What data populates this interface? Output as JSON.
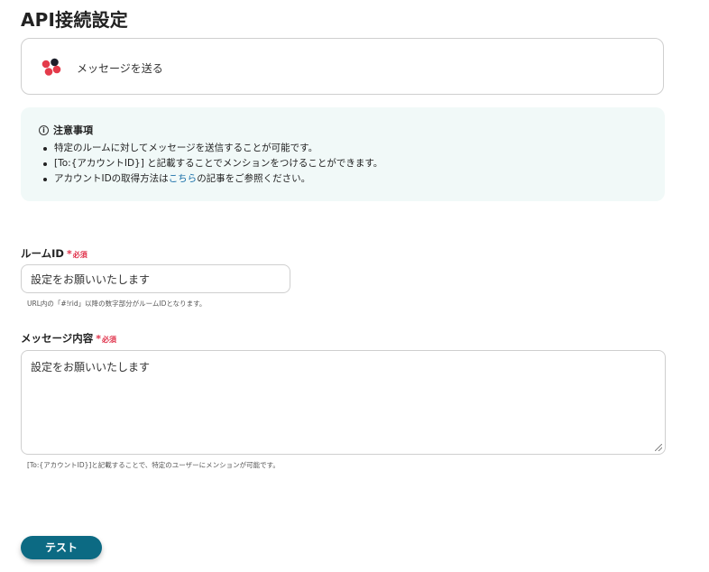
{
  "page": {
    "title": "API接続設定"
  },
  "action": {
    "label": "メッセージを送る",
    "icon": "chatwork-logo-icon"
  },
  "notice": {
    "title": "注意事項",
    "items": [
      "特定のルームに対してメッセージを送信することが可能です。",
      "[To:{アカウントID}] と記載することでメンションをつけることができます。"
    ],
    "item3_prefix": "アカウントIDの取得方法は",
    "item3_link": "こちら",
    "item3_suffix": "の記事をご参照ください。"
  },
  "room_id": {
    "label": "ルームID",
    "required_mark": "*",
    "required_text": "必須",
    "value": "設定をお願いいたします",
    "hint": "URL内の「#!rid」以降の数字部分がルームIDとなります。"
  },
  "message": {
    "label": "メッセージ内容",
    "required_mark": "*",
    "required_text": "必須",
    "value": "設定をお願いいたします",
    "hint": "[To:{アカウントID}]と記載することで、特定のユーザーにメンションが可能です。"
  },
  "test_button": {
    "label": "テスト"
  },
  "colors": {
    "accent": "#0c6a83",
    "required": "#e0314a",
    "notice_bg": "#f1f9f8",
    "link": "#1a6fa8"
  }
}
